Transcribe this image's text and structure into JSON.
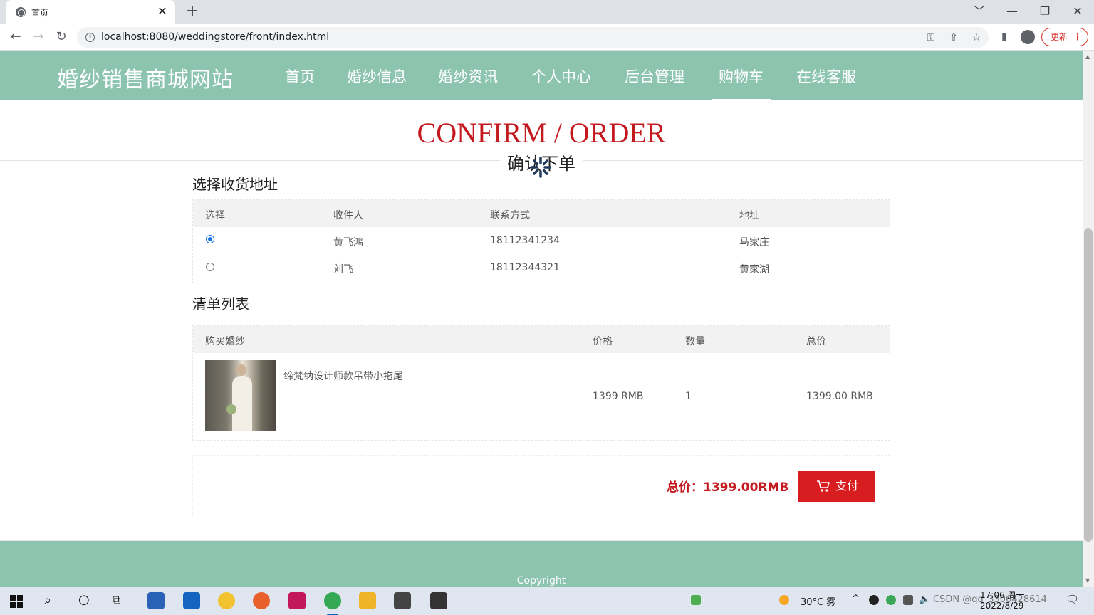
{
  "browser": {
    "tab_title": "首页",
    "tab_close": "✕",
    "new_tab": "+",
    "url": "localhost:8080/weddingstore/front/index.html",
    "update_label": "更新",
    "window_controls": [
      "﹀",
      "—",
      "❐",
      "✕"
    ]
  },
  "site": {
    "title": "婚纱销售商城网站",
    "nav": [
      "首页",
      "婚纱信息",
      "婚纱资讯",
      "个人中心",
      "后台管理",
      "购物车",
      "在线客服"
    ],
    "active_nav": "购物车"
  },
  "page": {
    "heading_en": "CONFIRM / ORDER",
    "heading_cn": "确认下单"
  },
  "address": {
    "section_title": "选择收货地址",
    "columns": [
      "选择",
      "收件人",
      "联系方式",
      "地址"
    ],
    "rows": [
      {
        "selected": true,
        "name": "黄飞鸿",
        "phone": "18112341234",
        "address": "马家庄"
      },
      {
        "selected": false,
        "name": "刘飞",
        "phone": "18112344321",
        "address": "黄家湖"
      }
    ]
  },
  "order": {
    "section_title": "清单列表",
    "columns": [
      "购买婚纱",
      "价格",
      "数量",
      "总价"
    ],
    "items": [
      {
        "name": "缔梵纳设计师款吊带小拖尾",
        "price": "1399 RMB",
        "quantity": "1",
        "total": "1399.00 RMB"
      }
    ]
  },
  "summary": {
    "total_label": "总价：1399.00RMB",
    "pay_label": "支付"
  },
  "footer": {
    "copyright": "Copyright"
  },
  "taskbar": {
    "weather": "30°C 雾",
    "time": "17:06 周一",
    "date": "2022/8/29",
    "watermark": "CSDN @qq_3306428614"
  },
  "colors": {
    "header_bg": "#8cc4b0",
    "accent_red": "#c4191f",
    "pay_button": "#d71d20"
  }
}
